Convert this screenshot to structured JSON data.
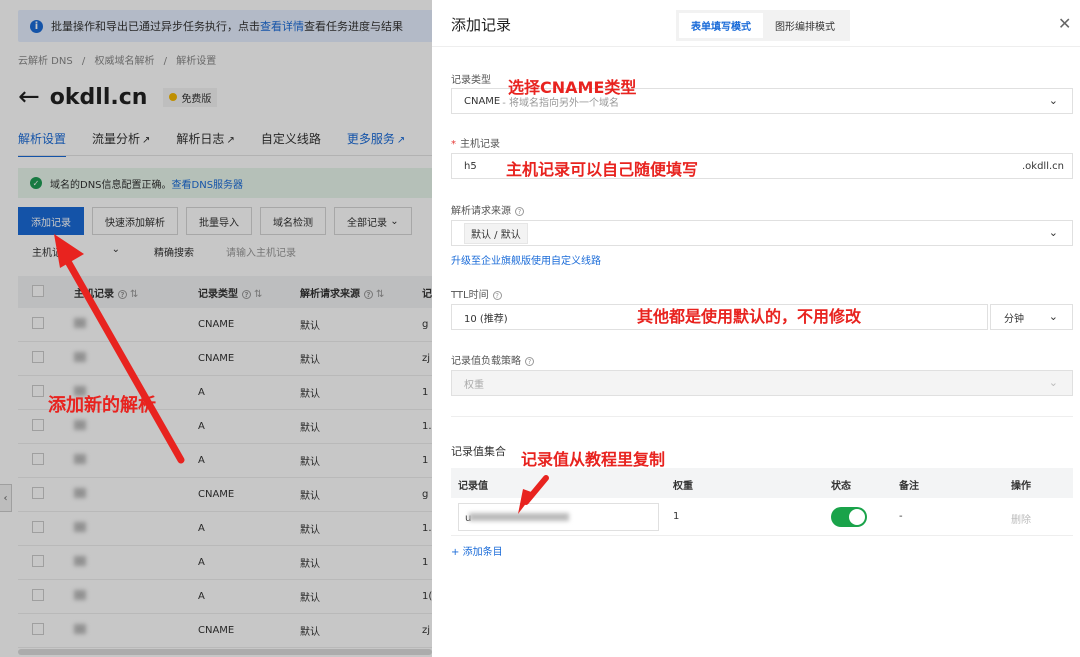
{
  "background": {
    "notice": {
      "prefix": "批量操作和导出已通过异步任务执行，点击",
      "link": "查看详情",
      "suffix": "查看任务进度与结果"
    },
    "breadcrumb": [
      "云解析 DNS",
      "/",
      "权威域名解析",
      "/",
      "解析设置"
    ],
    "domain": "okdll.cn",
    "plan_badge": "免费版",
    "tabs": [
      "解析设置",
      "流量分析",
      "解析日志",
      "自定义线路",
      "更多服务"
    ],
    "dns_status": {
      "text": "域名的DNS信息配置正确。",
      "link": "查看DNS服务器"
    },
    "toolbar": [
      "添加记录",
      "快速添加解析",
      "批量导入",
      "域名检测",
      "全部记录"
    ],
    "filter": {
      "field": "主机记录",
      "mode": "精确搜索",
      "placeholder": "请输入主机记录"
    },
    "table": {
      "headers": [
        "主机记录",
        "记录类型",
        "解析请求来源",
        "记"
      ],
      "rows": [
        {
          "type": "CNAME",
          "source": "默认",
          "tail": "g"
        },
        {
          "type": "CNAME",
          "source": "默认",
          "tail": "zj"
        },
        {
          "type": "A",
          "source": "默认",
          "tail": "1"
        },
        {
          "type": "A",
          "source": "默认",
          "tail": "1."
        },
        {
          "type": "A",
          "source": "默认",
          "tail": "1"
        },
        {
          "type": "CNAME",
          "source": "默认",
          "tail": "g"
        },
        {
          "type": "A",
          "source": "默认",
          "tail": "1."
        },
        {
          "type": "A",
          "source": "默认",
          "tail": "1"
        },
        {
          "type": "A",
          "source": "默认",
          "tail": "1("
        },
        {
          "type": "CNAME",
          "source": "默认",
          "tail": "zj"
        }
      ]
    }
  },
  "drawer": {
    "title": "添加记录",
    "modes": [
      "表单填写模式",
      "图形编排模式"
    ],
    "record_type": {
      "label": "记录类型",
      "value": "CNAME",
      "hint": "- 将域名指向另外一个域名"
    },
    "host": {
      "label": "主机记录",
      "value": "h5",
      "suffix": ".okdll.cn"
    },
    "source": {
      "label": "解析请求来源",
      "value": "默认 / 默认",
      "upgrade_link": "升级至企业旗舰版使用自定义线路"
    },
    "ttl": {
      "label": "TTL时间",
      "value": "10 (推荐)",
      "unit": "分钟"
    },
    "lb": {
      "label": "记录值负载策略",
      "value": "权重"
    },
    "values": {
      "label": "记录值集合",
      "headers": [
        "记录值",
        "权重",
        "状态",
        "备注",
        "操作"
      ],
      "row": {
        "value_prefix": "u",
        "weight": "1",
        "remark": "-",
        "action": "删除"
      },
      "add_label": "添加条目"
    }
  },
  "annotations": {
    "cname": "选择CNAME类型",
    "host": "主机记录可以自己随便填写",
    "defaults": "其他都是使用默认的，不用修改",
    "value": "记录值从教程里复制",
    "add": "添加新的解析"
  },
  "colors": {
    "primary": "#1a6bd8",
    "annotation": "#e8231f",
    "toggle_on": "#1aa34a"
  }
}
